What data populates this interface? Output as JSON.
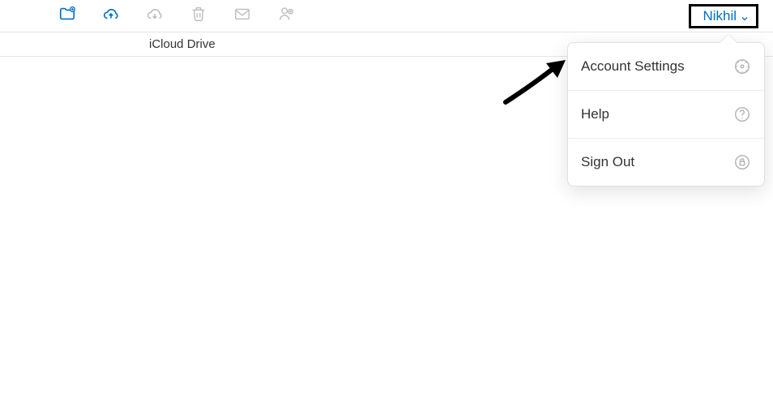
{
  "header": {
    "user_name": "Nikhil"
  },
  "breadcrumb": {
    "current": "iCloud Drive"
  },
  "dropdown": {
    "items": [
      {
        "label": "Account Settings"
      },
      {
        "label": "Help"
      },
      {
        "label": "Sign Out"
      }
    ]
  }
}
